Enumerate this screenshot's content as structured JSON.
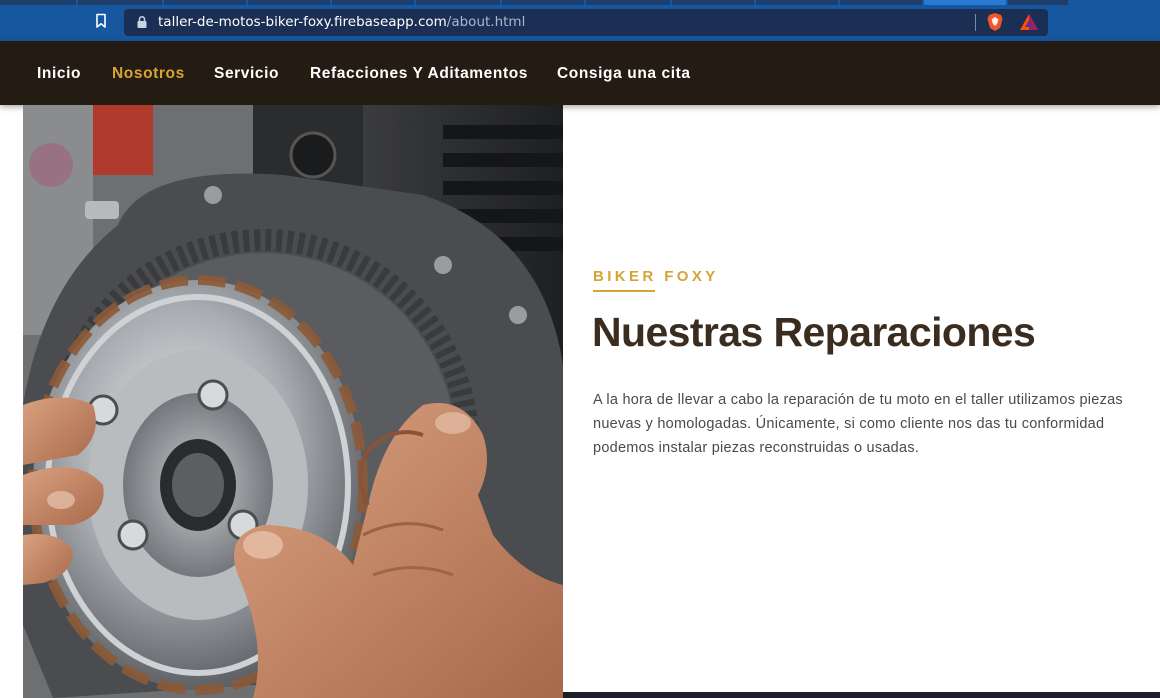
{
  "browser": {
    "url_host": "taller-de-motos-biker-foxy.firebaseapp.com",
    "url_path": "/about.html",
    "icons": [
      "bookmark-icon",
      "lock-icon",
      "brave-shield-icon",
      "brave-rewards-icon"
    ],
    "colors": {
      "chrome": "#17579f",
      "address_bar": "#1b2f55"
    }
  },
  "nav": {
    "items": [
      {
        "label": "Inicio",
        "active": false
      },
      {
        "label": "Nosotros",
        "active": true
      },
      {
        "label": "Servicio",
        "active": false
      },
      {
        "label": "Refacciones Y Aditamentos",
        "active": false
      },
      {
        "label": "Consiga una cita",
        "active": false
      }
    ],
    "colors": {
      "background": "#241c13",
      "active": "#d9a532",
      "text": "#ffffff"
    }
  },
  "about": {
    "eyebrow": "BIKER FOXY",
    "title": "Nuestras Reparaciones",
    "body": "A la hora de llevar a cabo la reparación de tu moto en el taller utilizamos piezas nuevas y homologadas. Únicamente, si como cliente nos das tu conformidad podemos instalar piezas reconstruidas o usadas.",
    "colors": {
      "accent": "#d4a534",
      "title": "#3a2d1f",
      "body": "#4a4a4a"
    }
  }
}
